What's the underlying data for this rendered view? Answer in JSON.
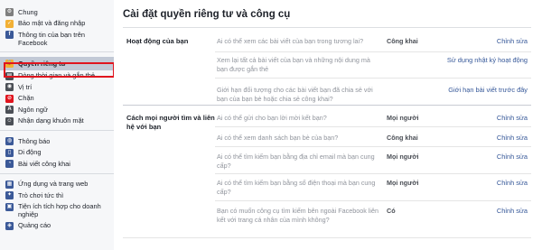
{
  "sidebar": {
    "groups": [
      {
        "items": [
          {
            "label": "Chung",
            "icon": "gear-icon",
            "color": "#7f7f7f"
          },
          {
            "label": "Bảo mật và đăng nhập",
            "icon": "shield-icon",
            "color": "#f2b035"
          },
          {
            "label": "Thông tin của bạn trên Facebook",
            "icon": "facebook-icon",
            "color": "#3b5998"
          }
        ]
      },
      {
        "items": [
          {
            "label": "Quyền riêng tư",
            "icon": "lock-icon",
            "color": "#f2b035",
            "active": true
          },
          {
            "label": "Dòng thời gian và gắn thẻ",
            "icon": "timeline-icon",
            "color": "#4b4f56"
          },
          {
            "label": "Vị trí",
            "icon": "location-pin-icon",
            "color": "#4b4f56"
          },
          {
            "label": "Chặn",
            "icon": "block-icon",
            "color": "#e0141e"
          },
          {
            "label": "Ngôn ngữ",
            "icon": "language-icon",
            "color": "#4b4f56"
          },
          {
            "label": "Nhận dạng khuôn mặt",
            "icon": "face-recognition-icon",
            "color": "#4b4f56"
          }
        ]
      },
      {
        "items": [
          {
            "label": "Thông báo",
            "icon": "globe-icon",
            "color": "#3b5998"
          },
          {
            "label": "Di động",
            "icon": "mobile-icon",
            "color": "#3b5998"
          },
          {
            "label": "Bài viết công khai",
            "icon": "rss-icon",
            "color": "#3b5998"
          }
        ]
      },
      {
        "items": [
          {
            "label": "Ứng dụng và trang web",
            "icon": "apps-icon",
            "color": "#3b5998"
          },
          {
            "label": "Trò chơi tức thì",
            "icon": "game-controller-icon",
            "color": "#3b5998"
          },
          {
            "label": "Tiện ích tích hợp cho doanh nghiệp",
            "icon": "business-icon",
            "color": "#3b5998"
          },
          {
            "label": "Quảng cáo",
            "icon": "ads-icon",
            "color": "#3b5998"
          }
        ]
      }
    ]
  },
  "main": {
    "title": "Cài đặt quyền riêng tư và công cụ",
    "sections": [
      {
        "title": "Hoạt động của bạn",
        "rows": [
          {
            "question": "Ai có thể xem các bài viết của bạn trong tương lai?",
            "value": "Công khai",
            "action": "Chỉnh sửa"
          },
          {
            "question": "Xem lại tất cả bài viết của bạn và những nội dung mà bạn được gắn thẻ",
            "value": "",
            "action": "Sử dụng nhật ký hoạt động"
          },
          {
            "question": "Giới hạn đối tượng cho các bài viết bạn đã chia sẻ với bạn của bạn bè hoặc chia sẻ công khai?",
            "value": "",
            "action": "Giới hạn bài viết trước đây"
          }
        ]
      },
      {
        "title": "Cách mọi người tìm và liên hệ với bạn",
        "rows": [
          {
            "question": "Ai có thể gửi cho bạn lời mời kết bạn?",
            "value": "Mọi người",
            "action": "Chỉnh sửa"
          },
          {
            "question": "Ai có thể xem danh sách bạn bè của bạn?",
            "value": "Công khai",
            "action": "Chỉnh sửa"
          },
          {
            "question": "Ai có thể tìm kiếm bạn bằng địa chỉ email mà bạn cung cấp?",
            "value": "Mọi người",
            "action": "Chỉnh sửa"
          },
          {
            "question": "Ai có thể tìm kiếm bạn bằng số điện thoại mà bạn cung cấp?",
            "value": "Mọi người",
            "action": "Chỉnh sửa"
          },
          {
            "question": "Bạn có muốn công cụ tìm kiếm bên ngoài Facebook liên kết với trang cá nhân của mình không?",
            "value": "Có",
            "action": "Chỉnh sửa"
          }
        ]
      }
    ]
  }
}
